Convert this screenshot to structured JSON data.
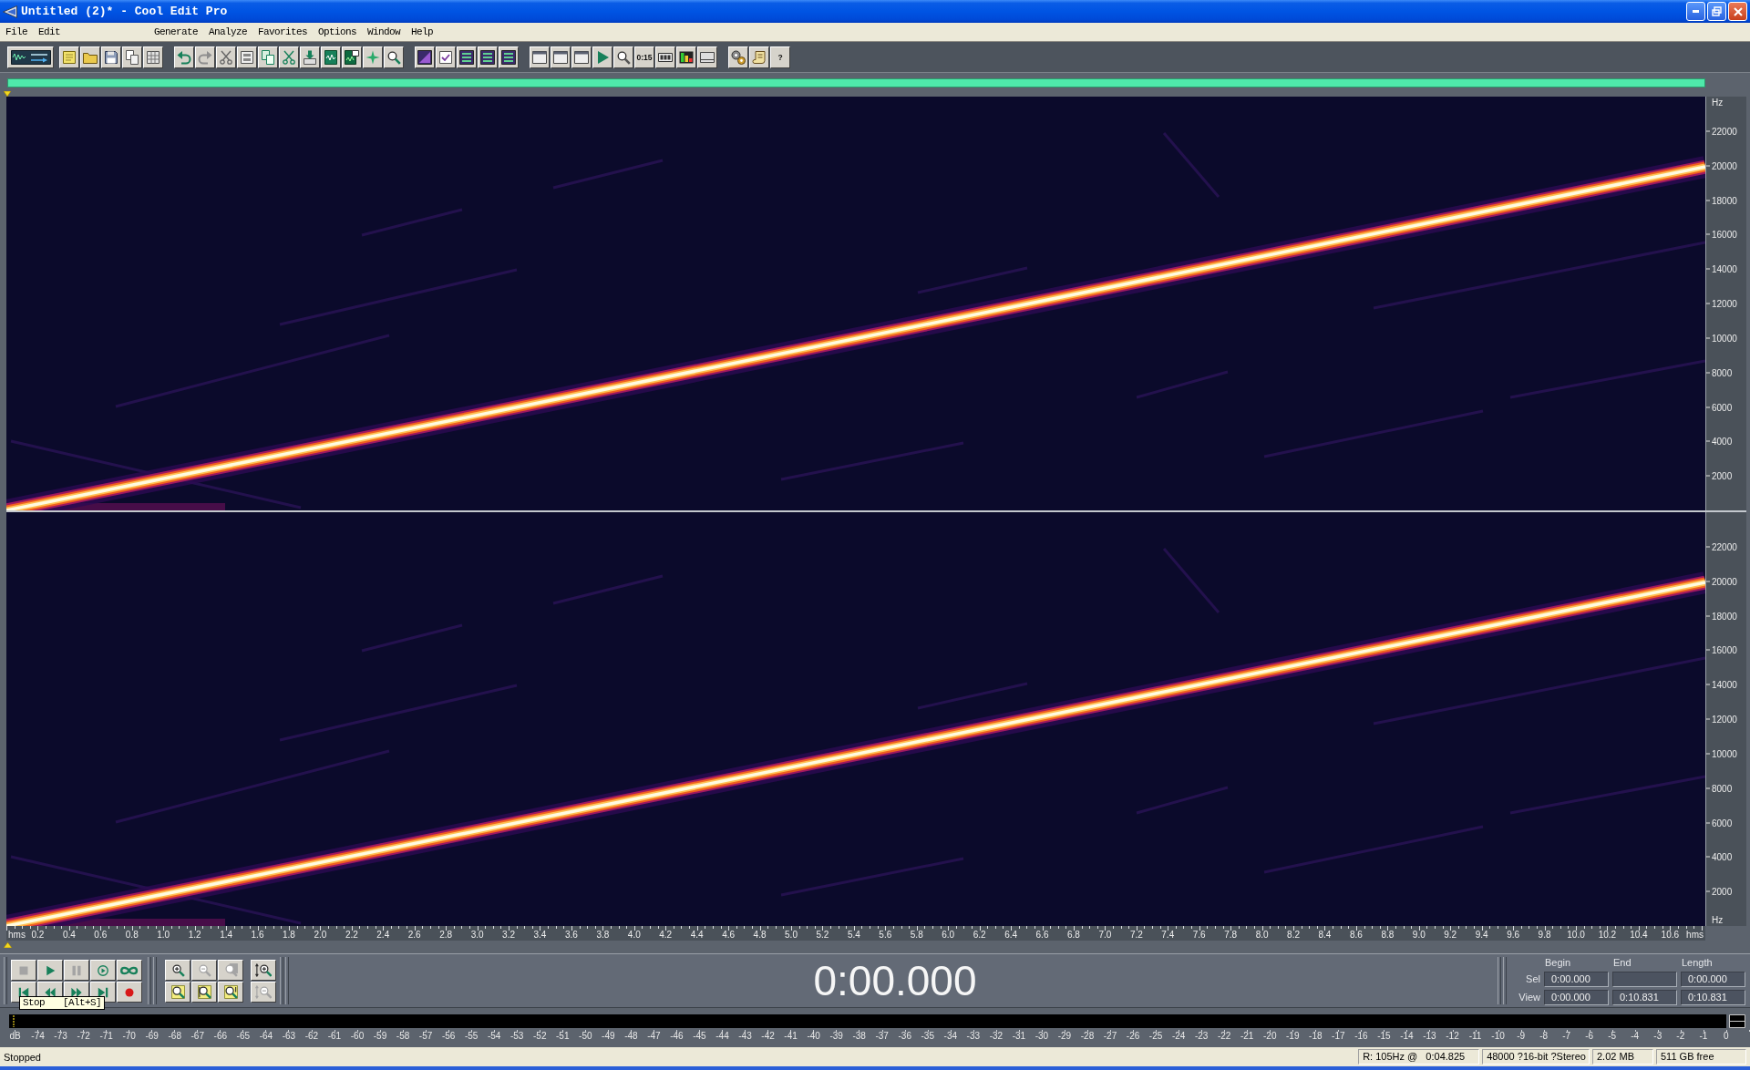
{
  "window": {
    "title": "Untitled (2)* - Cool Edit Pro"
  },
  "menu": [
    "File",
    "Edit",
    "Generate",
    "Analyze",
    "Favorites",
    "Options",
    "Window",
    "Help"
  ],
  "toolbar": [
    [
      {
        "kind": "waveform"
      },
      {
        "kind": "note"
      },
      {
        "kind": "folder"
      },
      {
        "kind": "disk"
      },
      {
        "kind": "pages"
      },
      {
        "kind": "grid"
      }
    ],
    [
      {
        "kind": "undo"
      },
      {
        "kind": "redo"
      },
      {
        "kind": "trim"
      },
      {
        "kind": "frame"
      },
      {
        "kind": "copy"
      },
      {
        "kind": "cut"
      },
      {
        "kind": "paste"
      },
      {
        "kind": "mix"
      },
      {
        "kind": "paste-new"
      },
      {
        "kind": "sparkle"
      },
      {
        "kind": "find"
      }
    ],
    [
      {
        "kind": "ramp"
      },
      {
        "kind": "check"
      },
      {
        "kind": "bars"
      },
      {
        "kind": "bars"
      },
      {
        "kind": "bars"
      }
    ],
    [
      {
        "kind": "window"
      },
      {
        "kind": "window"
      },
      {
        "kind": "window"
      },
      {
        "kind": "play"
      },
      {
        "kind": "zoom"
      },
      {
        "kind": "text",
        "label": "0:15"
      },
      {
        "kind": "blocks"
      },
      {
        "kind": "meter"
      },
      {
        "kind": "panel"
      }
    ],
    [
      {
        "kind": "gears"
      },
      {
        "kind": "scroll"
      },
      {
        "kind": "text",
        "label": "?"
      }
    ]
  ],
  "spectrogram": {
    "channels": [
      {
        "unit_top": "Hz",
        "ticks": [
          "22000",
          "20000",
          "18000",
          "16000",
          "14000",
          "12000",
          "10000",
          "8000",
          "6000",
          "4000",
          "2000"
        ]
      },
      {
        "ticks": [
          "22000",
          "20000",
          "18000",
          "16000",
          "14000",
          "12000",
          "10000",
          "8000",
          "6000",
          "4000",
          "2000"
        ],
        "unit_bottom": "Hz"
      }
    ]
  },
  "time_axis": {
    "unit_start": "hms",
    "ticks": [
      "0.2",
      "0.4",
      "0.6",
      "0.8",
      "1.0",
      "1.2",
      "1.4",
      "1.6",
      "1.8",
      "2.0",
      "2.2",
      "2.4",
      "2.6",
      "2.8",
      "3.0",
      "3.2",
      "3.4",
      "3.6",
      "3.8",
      "4.0",
      "4.2",
      "4.4",
      "4.6",
      "4.8",
      "5.0",
      "5.2",
      "5.4",
      "5.6",
      "5.8",
      "6.0",
      "6.2",
      "6.4",
      "6.6",
      "6.8",
      "7.0",
      "7.2",
      "7.4",
      "7.6",
      "7.8",
      "8.0",
      "8.2",
      "8.4",
      "8.6",
      "8.8",
      "9.0",
      "9.2",
      "9.4",
      "9.6",
      "9.8",
      "10.0",
      "10.2",
      "10.4",
      "10.6"
    ],
    "unit_end": "hms"
  },
  "transport": [
    {
      "kind": "stop",
      "disabled": true
    },
    {
      "kind": "play",
      "disabled": false
    },
    {
      "kind": "pause",
      "disabled": true
    },
    {
      "kind": "play-to-end",
      "disabled": false
    },
    {
      "kind": "loop",
      "disabled": false
    },
    {
      "kind": "go-to-start",
      "disabled": false
    },
    {
      "kind": "rewind",
      "disabled": false
    },
    {
      "kind": "fast-forward",
      "disabled": false
    },
    {
      "kind": "go-to-end",
      "disabled": false
    },
    {
      "kind": "record",
      "disabled": false
    }
  ],
  "zoom": [
    {
      "kind": "zoom-in",
      "disabled": false
    },
    {
      "kind": "zoom-out",
      "disabled": true
    },
    {
      "kind": "zoom-full",
      "disabled": true
    },
    {
      "kind": "zoom-selection",
      "disabled": false
    },
    {
      "kind": "zoom-left",
      "disabled": false
    },
    {
      "kind": "zoom-right",
      "disabled": false
    }
  ],
  "vertical_zoom": [
    {
      "kind": "vzoom-in",
      "disabled": false
    },
    {
      "kind": "vzoom-out",
      "disabled": true
    }
  ],
  "tooltip": {
    "text": "Stop",
    "shortcut": "[Alt+S]"
  },
  "time_display": "0:00.000",
  "selection": {
    "columns": [
      "Begin",
      "End",
      "Length"
    ],
    "rows": [
      {
        "label": "Sel",
        "begin": "0:00.000",
        "length": "0:00.000"
      },
      {
        "label": "View",
        "begin": "0:00.000",
        "end": "0:10.831",
        "length": "0:10.831"
      }
    ]
  },
  "level_meter": {
    "scale": [
      "dB",
      "-74",
      "-73",
      "-72",
      "-71",
      "-70",
      "-69",
      "-68",
      "-67",
      "-66",
      "-65",
      "-64",
      "-63",
      "-62",
      "-61",
      "-60",
      "-59",
      "-58",
      "-57",
      "-56",
      "-55",
      "-54",
      "-53",
      "-52",
      "-51",
      "-50",
      "-49",
      "-48",
      "-47",
      "-46",
      "-45",
      "-44",
      "-43",
      "-42",
      "-41",
      "-40",
      "-39",
      "-38",
      "-37",
      "-36",
      "-35",
      "-34",
      "-33",
      "-32",
      "-31",
      "-30",
      "-29",
      "-28",
      "-27",
      "-26",
      "-25",
      "-24",
      "-23",
      "-22",
      "-21",
      "-20",
      "-19",
      "-18",
      "-17",
      "-16",
      "-15",
      "-14",
      "-13",
      "-12",
      "-11",
      "-10",
      "-9",
      "-8",
      "-7",
      "-6",
      "-5",
      "-4",
      "-3",
      "-2",
      "-1",
      "0"
    ]
  },
  "status_bar": {
    "state": "Stopped",
    "panels": [
      "R: 105Hz @   0:04.825",
      "48000 ?16-bit ?Stereo",
      "2.02 MB",
      "511 GB free"
    ]
  }
}
